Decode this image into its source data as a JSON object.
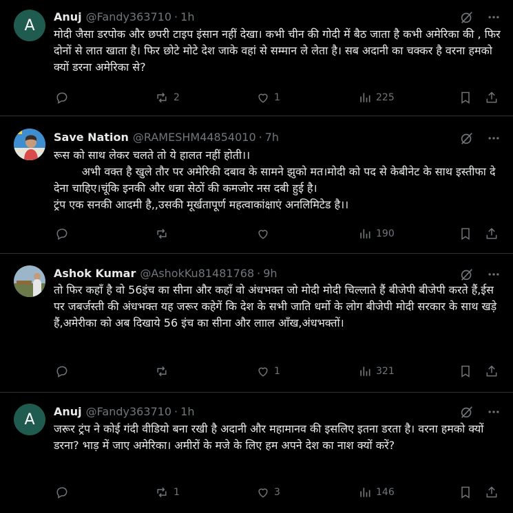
{
  "tweets": [
    {
      "avatar_letter": "A",
      "name": "Anuj",
      "handle": "@Fandy363710",
      "time": "1h",
      "text": "मोदी जैसा डरपोक और छपरी टाइप इंसान नहीं देखा। कभी चीन की गोदी में बैठ जाता है कभी अमेरिका की , फिर दोनों से लात खाता है। फिर छोटे मोटे देश जाके वहां से सम्मान ले लेता है। सब अदानी का चक्कर है वरना हमको क्यों डरना अमेरिका से?",
      "replies": "",
      "reposts": "2",
      "likes": "1",
      "views": "225"
    },
    {
      "avatar_letter": "",
      "name": "Save Nation",
      "handle": "@RAMESHM44854010",
      "time": "7h",
      "text": "रूस को साथ लेकर चलते तो ये हालत नहीं होती।।\n        अभी वक्त है खुले तौर पर अमेरिकी दबाव के सामने झुको मत।मोदी को पद से केबीनेट के साथ इस्तीफा दे देना चाहिए।चूंकि इनकी और धन्ना सेठों की कमजोर नस दबी हुई है।\nट्रंप एक सनकी आदमी है,,उसकी मूर्खतापूर्ण महत्वाकांक्षाएं अनलिमिटेड है।।",
      "replies": "",
      "reposts": "",
      "likes": "",
      "views": "190"
    },
    {
      "avatar_letter": "",
      "name": "Ashok Kumar",
      "handle": "@AshokKu81481768",
      "time": "9h",
      "text": "तो फिर कहाँ है वो 56इंच का सीना और कहाँ वो अंधभक्त जो मोदी मोदी चिल्लाते हैं बीजेपी बीजेपी करते हैं,ईस पर जबर्जस्ती की अंधभक्त यह जरूर कहेगें कि देश के सभी जाति धर्मो के लोग बीजेपी मोदी सरकार के साथ खड़े हैं,अमेरीका को अब दिखाये 56 इंच का सीना और लााल आँख,अंधभक्तों।",
      "replies": "",
      "reposts": "",
      "likes": "1",
      "views": "321"
    },
    {
      "avatar_letter": "A",
      "name": "Anuj",
      "handle": "@Fandy363710",
      "time": "1h",
      "text": "जरूर ट्रंप ने कोई गंदी वीडियो बना रखी है अदानी और महामानव की इसलिए इतना डरता है। वरना हमको क्यों डरना? भाड़ में जाए अमेरिका। अमीरों के मजे के लिए हम अपने देश का नाश क्यों करें?",
      "replies": "",
      "reposts": "1",
      "likes": "3",
      "views": "146"
    }
  ],
  "colors": {
    "background": "#000000",
    "text": "#e7e9ea",
    "muted": "#71767b",
    "divider": "#2f3336",
    "avatar_green": "#1f5c4f"
  },
  "icons": [
    "grok-icon",
    "more-icon",
    "reply-icon",
    "repost-icon",
    "like-icon",
    "views-icon",
    "bookmark-icon",
    "share-icon"
  ]
}
